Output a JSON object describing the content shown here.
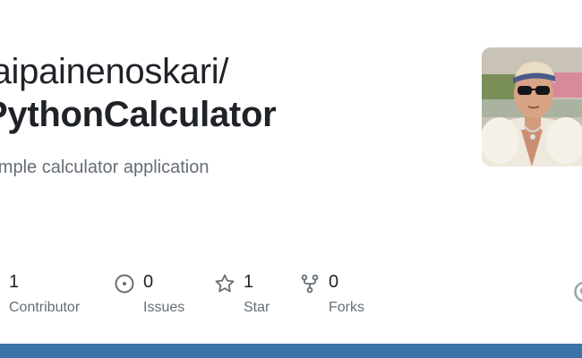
{
  "repo_card": {
    "owner": "jaipainenoskari/",
    "name": "PythonCalculator",
    "description": "Simple calculator application",
    "stats": [
      {
        "icon": "people-icon",
        "value": "1",
        "label": "Contributor"
      },
      {
        "icon": "issue-opened-icon",
        "value": "0",
        "label": "Issues"
      },
      {
        "icon": "star-icon",
        "value": "1",
        "label": "Star"
      },
      {
        "icon": "repo-forked-icon",
        "value": "0",
        "label": "Forks"
      }
    ],
    "avatar_icon": "owner-avatar",
    "edge_icon": "github-logo-icon"
  },
  "colors": {
    "text": "#1f2328",
    "muted": "#656d76",
    "bottom_bar": "#3b73a8"
  }
}
